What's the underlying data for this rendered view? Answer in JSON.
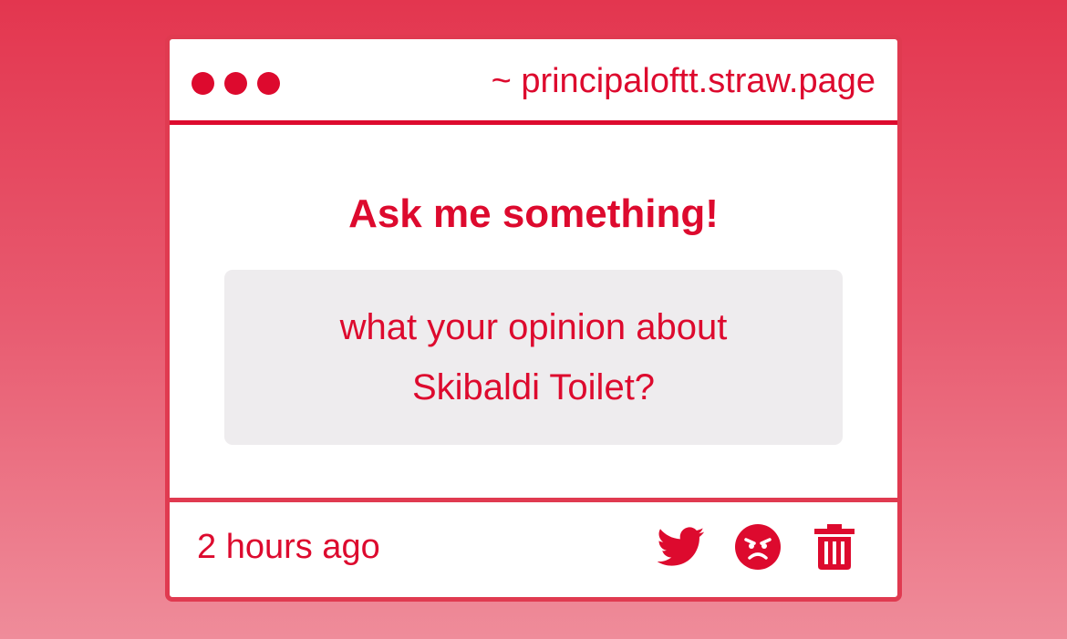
{
  "window": {
    "dots": 3,
    "url": "~ principaloftt.straw.page"
  },
  "main": {
    "heading": "Ask me something!",
    "question": "what your opinion about Skibaldi Toilet?"
  },
  "footer": {
    "timestamp": "2 hours ago",
    "actions": [
      {
        "name": "share-twitter",
        "icon": "twitter-icon"
      },
      {
        "name": "report",
        "icon": "angry-face-icon"
      },
      {
        "name": "delete",
        "icon": "trash-icon"
      }
    ]
  },
  "colors": {
    "accent": "#dd0a2e",
    "border": "#e03a50",
    "question_bg": "#eeecee",
    "background_top": "#e3364f",
    "background_bottom": "#ef8c9a"
  }
}
